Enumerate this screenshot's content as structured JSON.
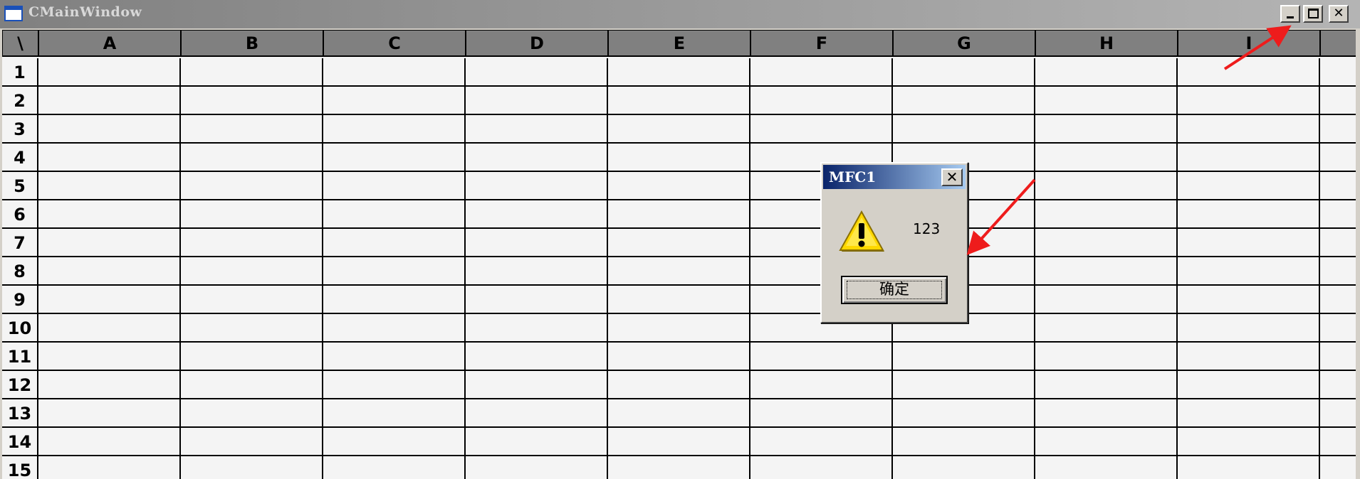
{
  "window": {
    "title": "CMainWindow",
    "minimize_label": "",
    "maximize_label": "",
    "close_label": "✕"
  },
  "grid": {
    "corner": "\\",
    "columns": [
      "A",
      "B",
      "C",
      "D",
      "E",
      "F",
      "G",
      "H",
      "I",
      ""
    ],
    "rows": [
      "1",
      "2",
      "3",
      "4",
      "5",
      "6",
      "7",
      "8",
      "9",
      "10",
      "11",
      "12",
      "13",
      "14",
      "15"
    ]
  },
  "dialog": {
    "title": "MFC1",
    "close_label": "✕",
    "icon": "warning-icon",
    "message": "123",
    "ok_label": "确定"
  },
  "annotation": {
    "arrow_color": "#ee1c1c"
  }
}
